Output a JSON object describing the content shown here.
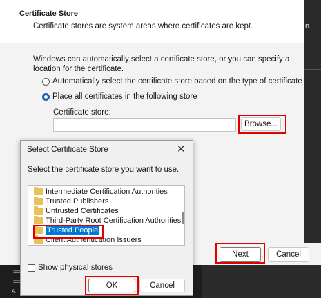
{
  "wizard": {
    "title": "Certificate Store",
    "subtitle": "Certificate stores are system areas where certificates are kept.",
    "description": "Windows can automatically select a certificate store, or you can specify a location for the certificate.",
    "radio_auto_label": "Automatically select the certificate store based on the type of certificate",
    "radio_manual_label": "Place all certificates in the following store",
    "radio_selected": "manual",
    "store_label": "Certificate store:",
    "store_value": "",
    "browse_label": "Browse...",
    "next_label": "Next",
    "cancel_label": "Cancel"
  },
  "dialog": {
    "title": "Select Certificate Store",
    "prompt": "Select the certificate store you want to use.",
    "tree_items": [
      {
        "label": "Intermediate Certification Authorities",
        "selected": false
      },
      {
        "label": "Trusted Publishers",
        "selected": false
      },
      {
        "label": "Untrusted Certificates",
        "selected": false
      },
      {
        "label": "Third-Party Root Certification Authorities",
        "selected": false
      },
      {
        "label": "Trusted People",
        "selected": true
      },
      {
        "label": "Client Authentication Issuers",
        "selected": false
      }
    ],
    "show_physical_label": "Show physical stores",
    "show_physical_checked": false,
    "ok_label": "OK",
    "cancel_label": "Cancel"
  },
  "background": {
    "right_fragment": "n",
    "console_lines": [
      "==",
      "==",
      "A"
    ]
  },
  "colors": {
    "highlight": "#e00000",
    "selection": "#0078d7",
    "folder": "#e8c15a"
  }
}
